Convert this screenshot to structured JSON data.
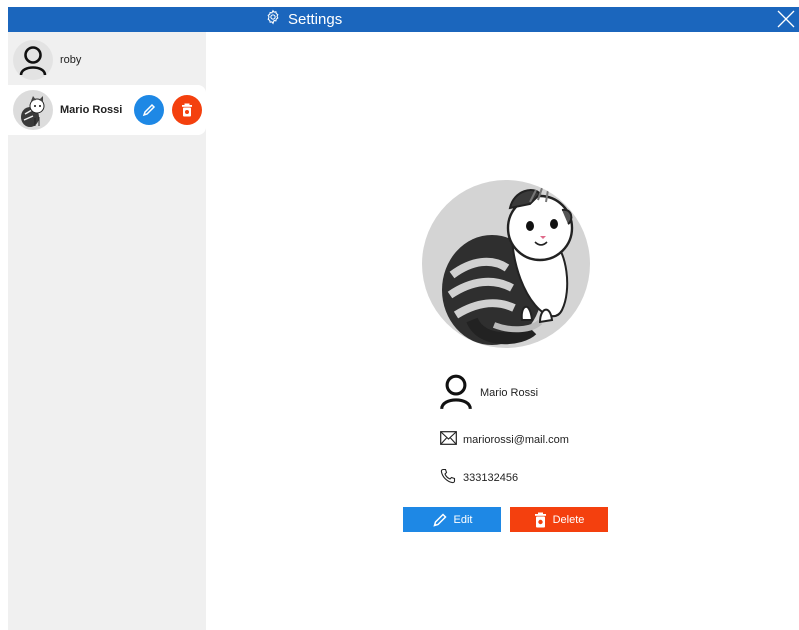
{
  "window": {
    "title": "Settings"
  },
  "users": [
    {
      "name": "roby",
      "avatar_icon": "person-outline-icon"
    },
    {
      "name": "Mario Rossi",
      "avatar_icon": "cat-avatar",
      "selected": true
    }
  ],
  "profile": {
    "name": "Mario Rossi",
    "email": "mariorossi@mail.com",
    "phone": "333132456"
  },
  "actions": {
    "edit_label": "Edit",
    "delete_label": "Delete"
  },
  "colors": {
    "titlebar": "#1b66bd",
    "edit": "#1e88e5",
    "delete": "#f4400e",
    "sidebar": "#f0f0f0"
  }
}
